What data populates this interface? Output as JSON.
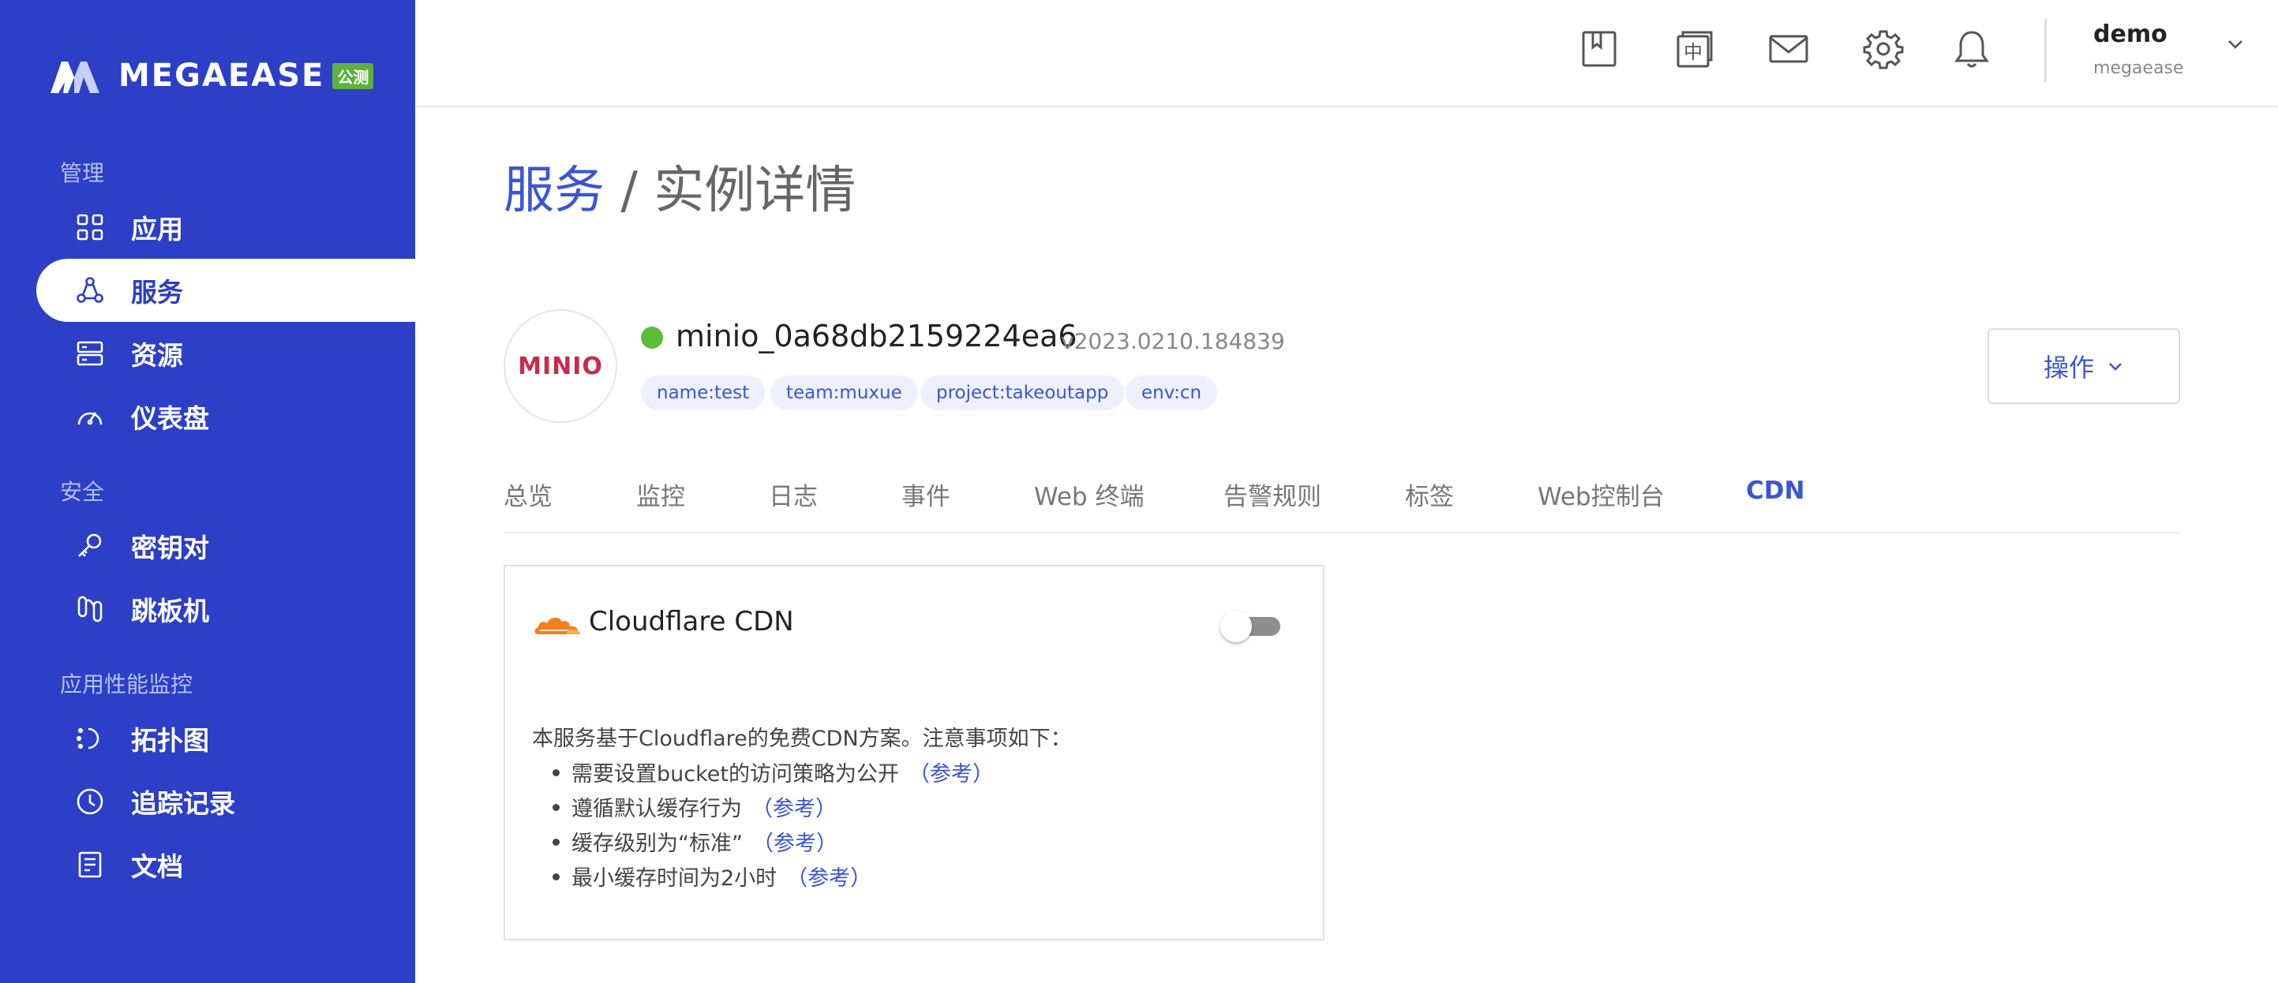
{
  "brand": {
    "name": "MEGAEASE",
    "badge": "公测"
  },
  "sidebar": {
    "groups": [
      {
        "title": "管理",
        "items": [
          {
            "label": "应用",
            "icon": "apps-grid-icon"
          },
          {
            "label": "服务",
            "icon": "service-nodes-icon",
            "active": true
          },
          {
            "label": "资源",
            "icon": "server-icon"
          },
          {
            "label": "仪表盘",
            "icon": "gauge-icon"
          }
        ]
      },
      {
        "title": "安全",
        "items": [
          {
            "label": "密钥对",
            "icon": "key-icon"
          },
          {
            "label": "跳板机",
            "icon": "jump-host-icon"
          }
        ]
      },
      {
        "title": "应用性能监控",
        "items": [
          {
            "label": "拓扑图",
            "icon": "topology-icon"
          },
          {
            "label": "追踪记录",
            "icon": "clock-icon"
          },
          {
            "label": "文档",
            "icon": "document-icon"
          }
        ]
      }
    ]
  },
  "header": {
    "icons": [
      "bookmark-icon",
      "language-zh-icon",
      "mail-icon",
      "gear-icon",
      "bell-icon"
    ],
    "lang_glyph": "中",
    "user": {
      "name": "demo",
      "org": "megaease"
    }
  },
  "breadcrumb": {
    "parent": "服务",
    "separator": " / ",
    "current": "实例详情"
  },
  "instance": {
    "logo_text": "MINIO",
    "name": "minio_0a68db2159224ea6",
    "version": "v2023.0210.184839",
    "status_color": "#5cbd3b",
    "tags": [
      "name:test",
      "team:muxue",
      "project:takeoutapp",
      "env:cn"
    ]
  },
  "actions": {
    "ops_label": "操作"
  },
  "tabs": [
    "总览",
    "监控",
    "日志",
    "事件",
    "Web 终端",
    "告警规则",
    "标签",
    "Web控制台",
    "CDN"
  ],
  "active_tab": "CDN",
  "cdn": {
    "title": "Cloudflare CDN",
    "enabled": false,
    "intro": "本服务基于Cloudflare的免费CDN方案。注意事项如下：",
    "notes": [
      {
        "text": "需要设置bucket的访问策略为公开",
        "ref": "（参考）"
      },
      {
        "text": "遵循默认缓存行为",
        "ref": "（参考）"
      },
      {
        "text": "缓存级别为“标准”",
        "ref": "（参考）"
      },
      {
        "text": "最小缓存时间为2小时",
        "ref": "（参考）"
      }
    ]
  },
  "colors": {
    "sidebar": "#2c3fc6",
    "accent": "#3a56d4",
    "cloudflare": "#f38020"
  }
}
